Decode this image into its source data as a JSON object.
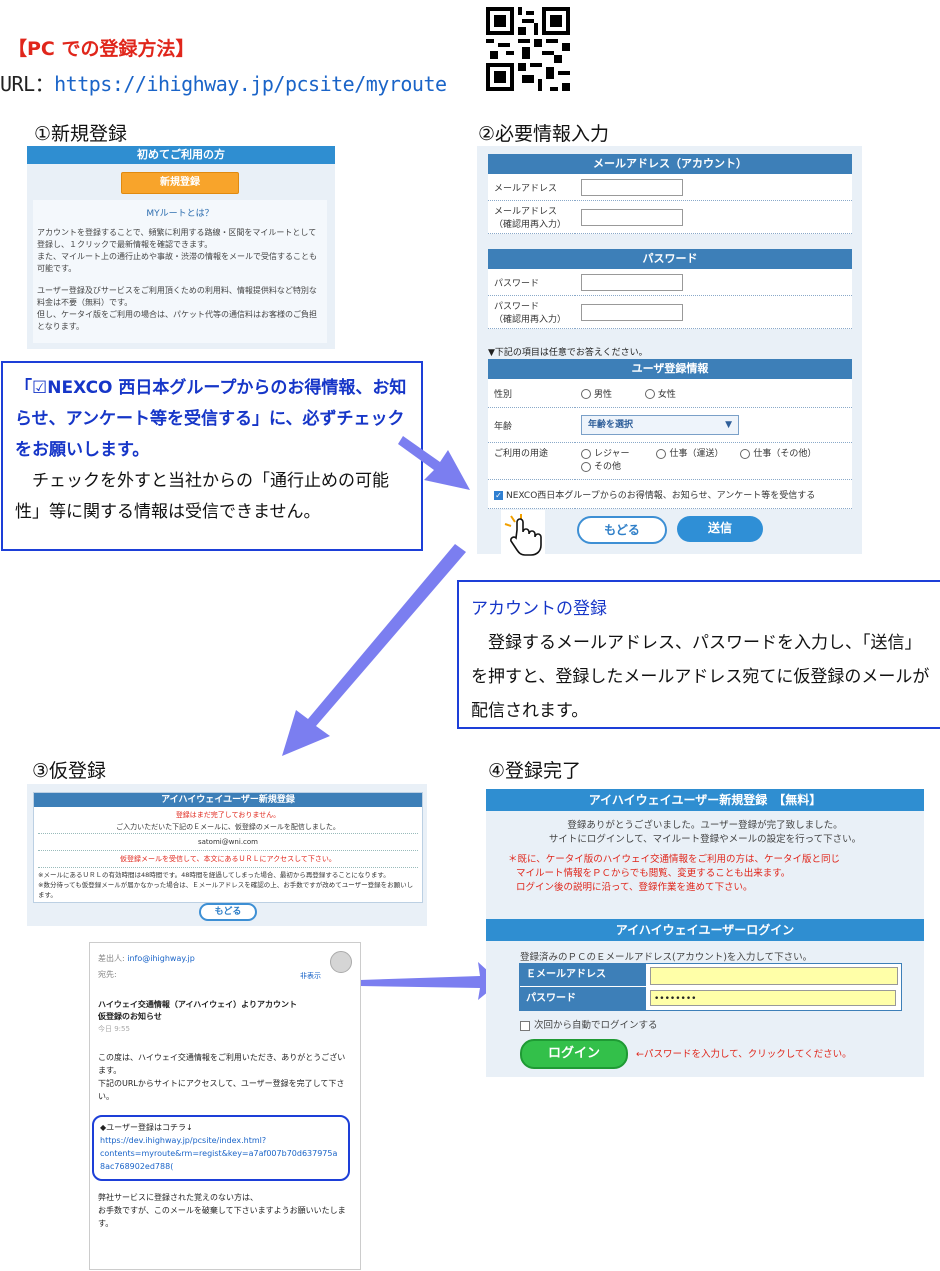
{
  "header": {
    "title": "【PC での登録方法】",
    "url_label": "URL：",
    "url": "https://ihighway.jp/pcsite/myroute"
  },
  "steps": {
    "s1": "①新規登録",
    "s2": "②必要情報入力",
    "s3": "③仮登録",
    "s4": "④登録完了"
  },
  "step1": {
    "header": "初めてご利用の方",
    "button": "新規登録",
    "about_title": "MYルートとは？",
    "p1": "アカウントを登録することで、頻繁に利用する路線・区間をマイルートとして登録し、１クリックで最新情報を確認できます。",
    "p2": "また、マイルート上の通行止めや事故・渋滞の情報をメールで受信することも可能です。",
    "p3": "ユーザー登録及びサービスをご利用頂くための利用料、情報提供料など特別な料金は不要（無料）です。",
    "p4": "但し、ケータイ版をご利用の場合は、パケット代等の通信料はお客様のご負担となります。"
  },
  "callout1": {
    "bold": "「☑NEXCO 西日本グループからのお得情報、お知らせ、アンケート等を受信する」に、必ずチェックをお願いします。",
    "body": "　チェックを外すと当社からの「通行止めの可能性」等に関する情報は受信できません。"
  },
  "step2": {
    "sec_mail": "メールアドレス（アカウント）",
    "mail": "メールアドレス",
    "mail_confirm_1": "メールアドレス",
    "mail_confirm_2": "（確認用再入力）",
    "sec_pw": "パスワード",
    "pw": "パスワード",
    "pw_confirm_1": "パスワード",
    "pw_confirm_2": "（確認用再入力）",
    "optional_note": "▼下記の項目は任意でお答えください。",
    "sec_user": "ユーザ登録情報",
    "gender": "性別",
    "male": "男性",
    "female": "女性",
    "age": "年齢",
    "age_select": "年齢を選択",
    "purpose": "ご利用の用途",
    "leisure": "レジャー",
    "work_transport": "仕事（運送）",
    "work_other": "仕事（その他）",
    "other": "その他",
    "checkbox_label": "NEXCO西日本グループからのお得情報、お知らせ、アンケート等を受信する",
    "back": "もどる",
    "send": "送信"
  },
  "callout2": {
    "title": "アカウントの登録",
    "body": "　登録するメールアドレス、パスワードを入力し、「送信」を押すと、登録したメールアドレス宛てに仮登録のメールが配信されます。"
  },
  "step3": {
    "header": "アイハイウェイユーザー新規登録",
    "warn": "登録はまだ完了しておりません。",
    "sent": "ご入力いただいた下記のＥメールに、仮登録のメールを配信しました。",
    "email": "satomi@wni.com",
    "instruct": "仮登録メールを受信して、本文にあるＵＲＬにアクセスして下さい。",
    "note1": "※メールにあるＵＲＬの有効時間は48時間です。48時間を経過してしまった場合、最初から再登録することになります。",
    "note2": "※数分待っても仮登録メールが届かなかった場合は、Ｅメールアドレスを確認の上、お手数ですが改めてユーザー登録をお願いします。",
    "back": "もどる"
  },
  "mail": {
    "from_label": "差出人:",
    "from": "info@ihighway.jp",
    "to_label": "宛先:",
    "hide": "非表示",
    "subject1": "ハイウェイ交通情報（アイハイウェイ）よりアカウント",
    "subject2": "仮登録のお知らせ",
    "time": "今日 9:55",
    "body1": "この度は、ハイウェイ交通情報をご利用いただき、ありがとうございます。",
    "body2": "下記のURLからサイトにアクセスして、ユーザー登録を完了して下さい。",
    "link_label": "◆ユーザー登録はコチラ↓",
    "link1": "https://dev.ihighway.jp/pcsite/index.html?",
    "link2": "contents=myroute&rm=regist&key=a7af007b70d637975a",
    "link3": "8ac768902ed788(",
    "foot1": "弊社サービスに登録された覚えのない方は、",
    "foot2": "お手数ですが、このメールを破棄して下さいますようお願いいたします。"
  },
  "step4": {
    "header": "アイハイウェイユーザー新規登録　【無料】",
    "done1": "登録ありがとうございました。ユーザー登録が完了致しました。",
    "done2": "サイトにログインして、マイルート登録やメールの設定を行って下さい。",
    "red1": "＊既に、ケータイ版のハイウェイ交通情報をご利用の方は、ケータイ版と同じ",
    "red2": "マイルート情報をＰＣからでも閲覧、変更することも出来ます。",
    "red3": "ログイン後の説明に沿って、登録作業を進めて下さい。",
    "login_header": "アイハイウェイユーザーログイン",
    "login_prompt": "登録済みのＰＣのＥメールアドレス(アカウント)を入力して下さい。",
    "email_label": "Ｅメールアドレス",
    "pw_label": "パスワード",
    "pw_value": "••••••••",
    "auto_login": "次回から自動でログインする",
    "login_button": "ログイン",
    "login_hint": "←パスワードを入力して、クリックしてください。"
  },
  "colors": {
    "accent": "#2f8ed1",
    "red": "#e0261b",
    "callout": "#1d3fd8",
    "arrow": "#7b7ef0"
  }
}
